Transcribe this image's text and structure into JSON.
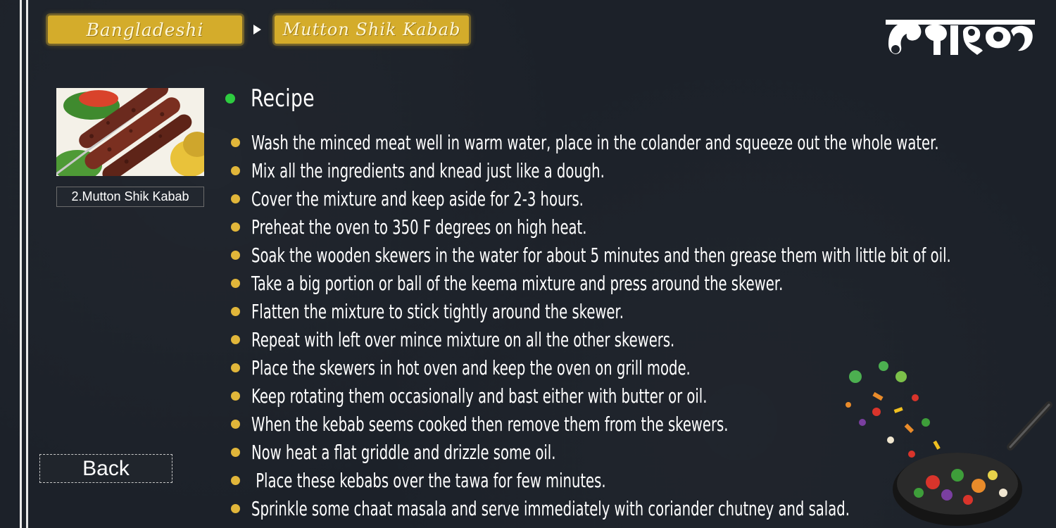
{
  "breadcrumb": {
    "items": [
      "Bangladeshi",
      "Mutton Shik Kabab"
    ]
  },
  "logo": {
    "icon": "bengali-wordmark-logo"
  },
  "recipe_card": {
    "caption": "2.Mutton Shik Kabab"
  },
  "recipe": {
    "title": "Recipe",
    "steps": [
      "Wash the minced meat well in warm water, place in the colander and squeeze out the whole water.",
      "Mix all the ingredients and knead just like a dough.",
      "Cover the mixture and keep aside for 2-3 hours.",
      "Preheat the oven to 350 F degrees on high heat.",
      "Soak the wooden skewers in the water for about 5 minutes and then grease them with little bit of oil.",
      "Take a big portion or ball of the keema mixture and press around the skewer.",
      "Flatten the mixture to stick tightly around the skewer.",
      "Repeat with left over mince mixture on all the other skewers.",
      "Place the skewers in hot oven and keep the oven on grill mode.",
      "Keep rotating them occasionally and bast either with butter or oil.",
      "When the kebab seems cooked then remove them from the skewers.",
      "Now heat a flat griddle and drizzle some oil.",
      " Place these kebabs over the tawa for few minutes.",
      "Sprinkle some chaat masala and serve immediately with coriander chutney and salad."
    ]
  },
  "back_button": {
    "label": "Back"
  },
  "colors": {
    "background": "#1c2129",
    "accent_gold": "#d4ac2b",
    "bullet": "#e1b63a",
    "title_dot": "#2ecc40"
  }
}
